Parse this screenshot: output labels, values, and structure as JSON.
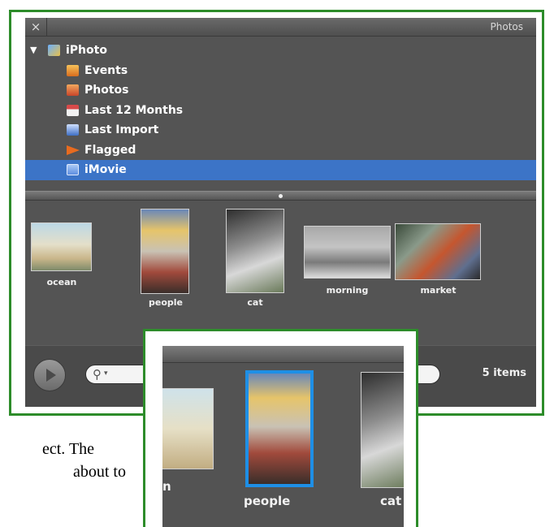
{
  "window": {
    "title": "Photos",
    "close_glyph": "×"
  },
  "tree": {
    "root": {
      "label": "iPhoto",
      "icon": "iphoto-icon",
      "expanded": true
    },
    "items": [
      {
        "label": "Events",
        "icon": "events-icon",
        "color": "#e0892a"
      },
      {
        "label": "Photos",
        "icon": "photos-icon",
        "color": "#d9652a"
      },
      {
        "label": "Last 12 Months",
        "icon": "calendar-icon",
        "color": "#c23a3a"
      },
      {
        "label": "Last Import",
        "icon": "import-icon",
        "color": "#4a78c8"
      },
      {
        "label": "Flagged",
        "icon": "flag-icon",
        "color": "#e86b1f"
      },
      {
        "label": "iMovie",
        "icon": "imovie-icon",
        "color": "#7aa6e8",
        "selected": true
      }
    ]
  },
  "photos": [
    {
      "caption": "ocean"
    },
    {
      "caption": "people"
    },
    {
      "caption": "cat"
    },
    {
      "caption": "morning"
    },
    {
      "caption": "market"
    }
  ],
  "toolbar": {
    "play_icon": "play-icon",
    "search_placeholder": "",
    "item_count": "5 items"
  },
  "zoom": {
    "selected_caption": "people",
    "captions": [
      "people",
      "cat",
      "n"
    ],
    "selection_color": "#1e8fe6"
  },
  "page_text": {
    "line1_fragment": "ect.  The",
    "line2_fragment": "about to"
  },
  "colors": {
    "frame_green": "#2d8c2a",
    "selection_blue": "#3c74c7",
    "panel_gray": "#545454"
  }
}
